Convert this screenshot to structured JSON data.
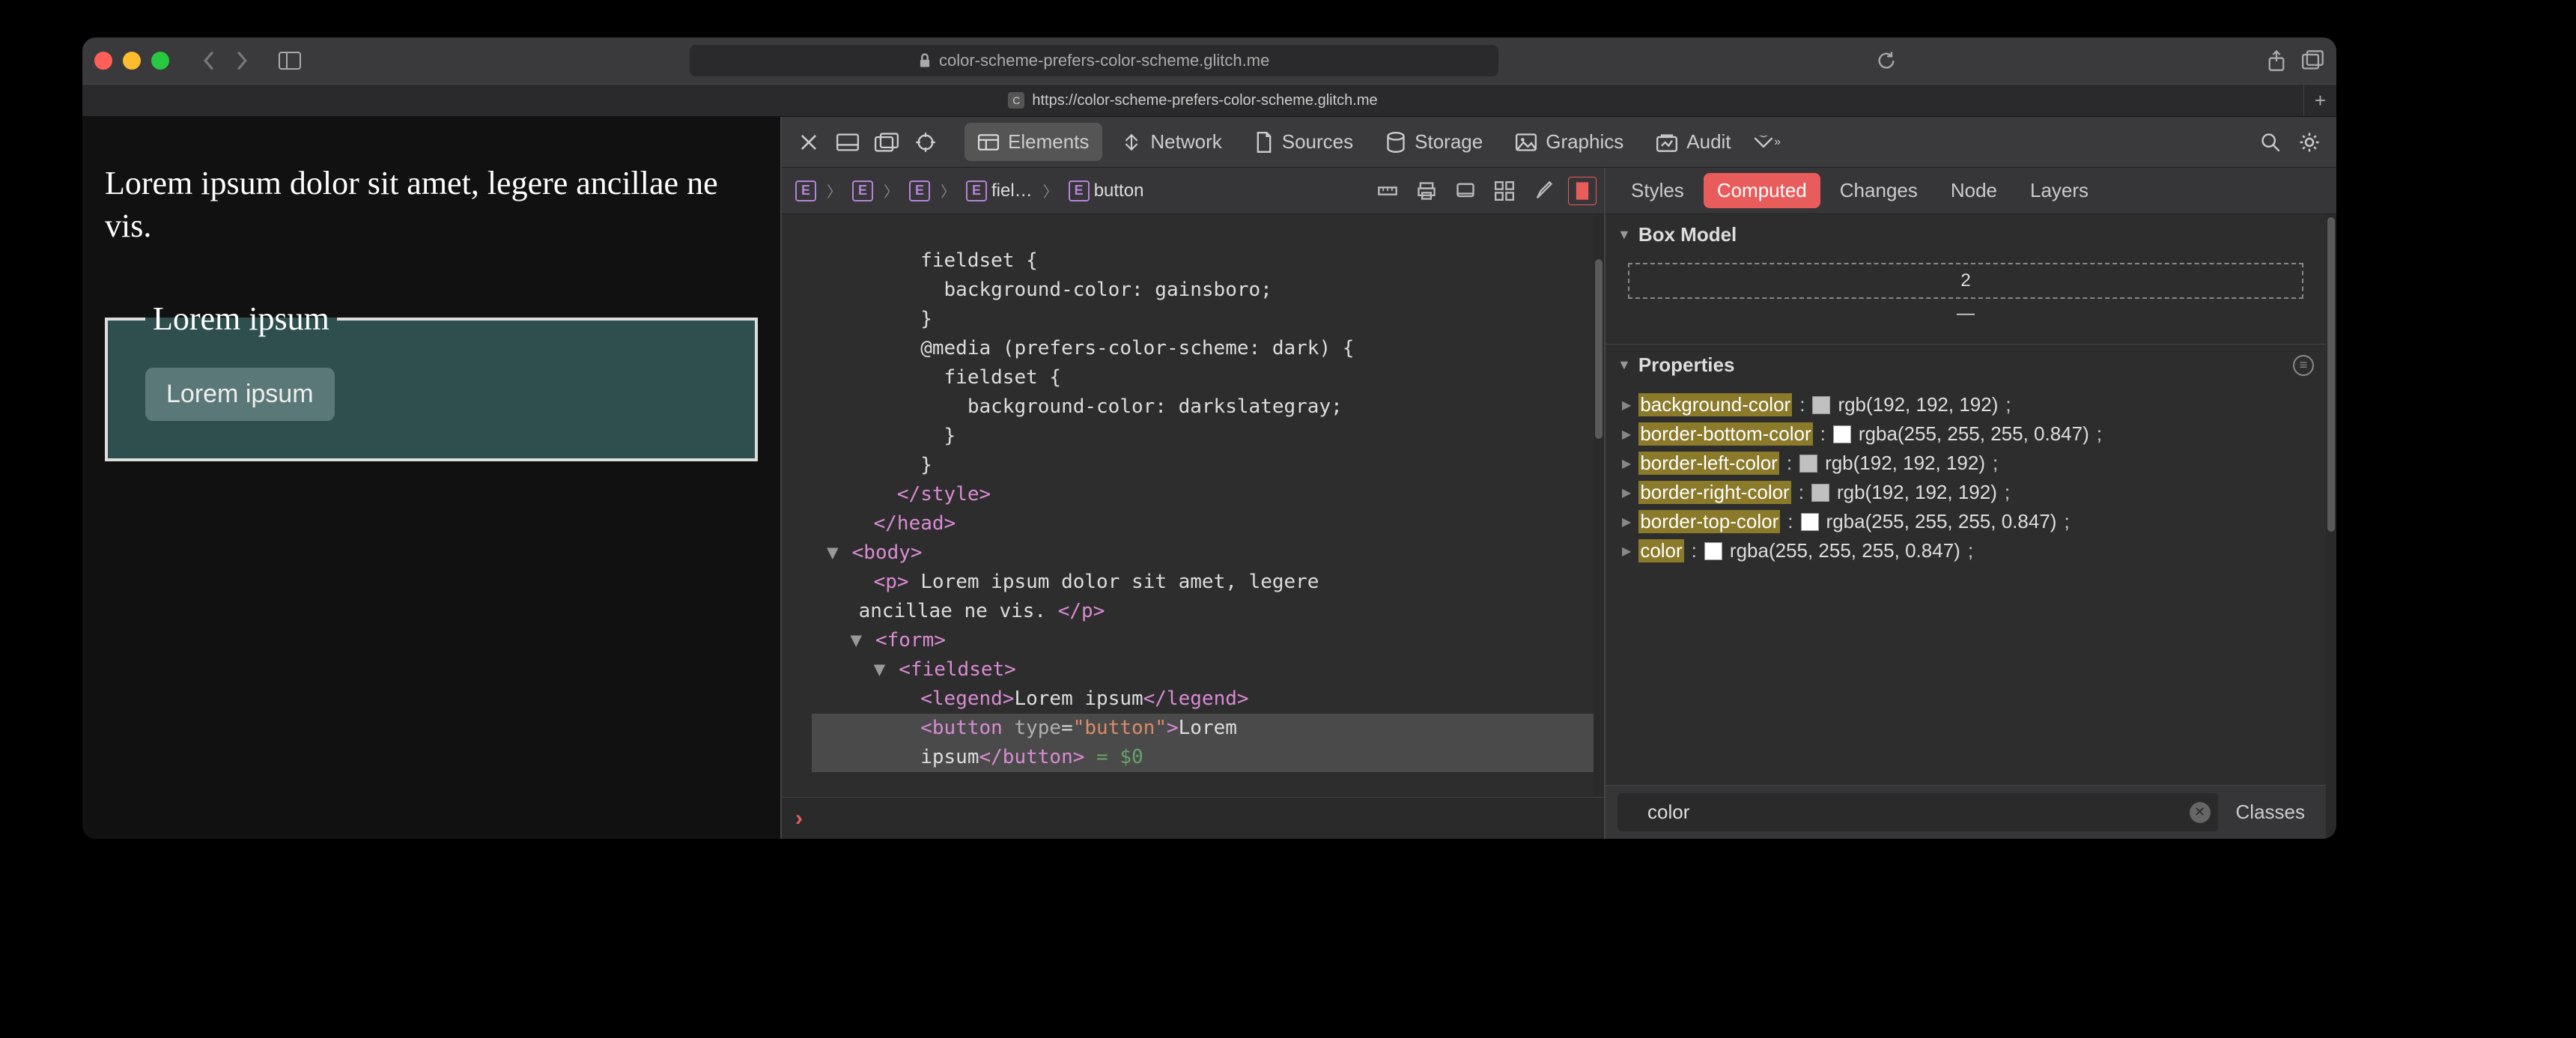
{
  "window": {
    "url_host": "color-scheme-prefers-color-scheme.glitch.me",
    "tab_url": "https://color-scheme-prefers-color-scheme.glitch.me",
    "reload_icon": "reload"
  },
  "page": {
    "paragraph": "Lorem ipsum dolor sit amet, legere ancillae ne vis.",
    "legend": "Lorem ipsum",
    "button": "Lorem ipsum"
  },
  "devtools": {
    "tabs": [
      "Elements",
      "Network",
      "Sources",
      "Storage",
      "Graphics",
      "Audit"
    ],
    "active_tab": "Elements",
    "breadcrumb": [
      "",
      "",
      "",
      "fiel…",
      "button"
    ],
    "source_lines": [
      "          fieldset {",
      "            background-color: gainsboro;",
      "          }",
      "          @media (prefers-color-scheme: dark) {",
      "            fieldset {",
      "              background-color: darkslategray;",
      "            }",
      "          }",
      "        </style>",
      "      </head>",
      "      <body>",
      "        <p> Lorem ipsum dolor sit amet, legere ancillae ne vis. </p>",
      "        <form>",
      "          <fieldset>",
      "            <legend>Lorem ipsum</legend>",
      "            <button type=\"button\">Lorem ipsum</button> = $0"
    ],
    "style_tabs": [
      "Styles",
      "Computed",
      "Changes",
      "Node",
      "Layers"
    ],
    "active_style_tab": "Computed",
    "box_model_title": "Box Model",
    "box_model_top": "2",
    "box_model_mid": "—",
    "properties_title": "Properties",
    "properties": [
      {
        "name": "background-color",
        "swatch": "#c0c0c0",
        "value": "rgb(192, 192, 192)"
      },
      {
        "name": "border-bottom-color",
        "swatch": "#ffffff",
        "value": "rgba(255, 255, 255, 0.847)"
      },
      {
        "name": "border-left-color",
        "swatch": "#c0c0c0",
        "value": "rgb(192, 192, 192)"
      },
      {
        "name": "border-right-color",
        "swatch": "#c0c0c0",
        "value": "rgb(192, 192, 192)"
      },
      {
        "name": "border-top-color",
        "swatch": "#ffffff",
        "value": "rgba(255, 255, 255, 0.847)"
      },
      {
        "name": "color",
        "swatch": "#ffffff",
        "value": "rgba(255, 255, 255, 0.847)"
      }
    ],
    "filter_value": "color",
    "classes_btn": "Classes"
  }
}
